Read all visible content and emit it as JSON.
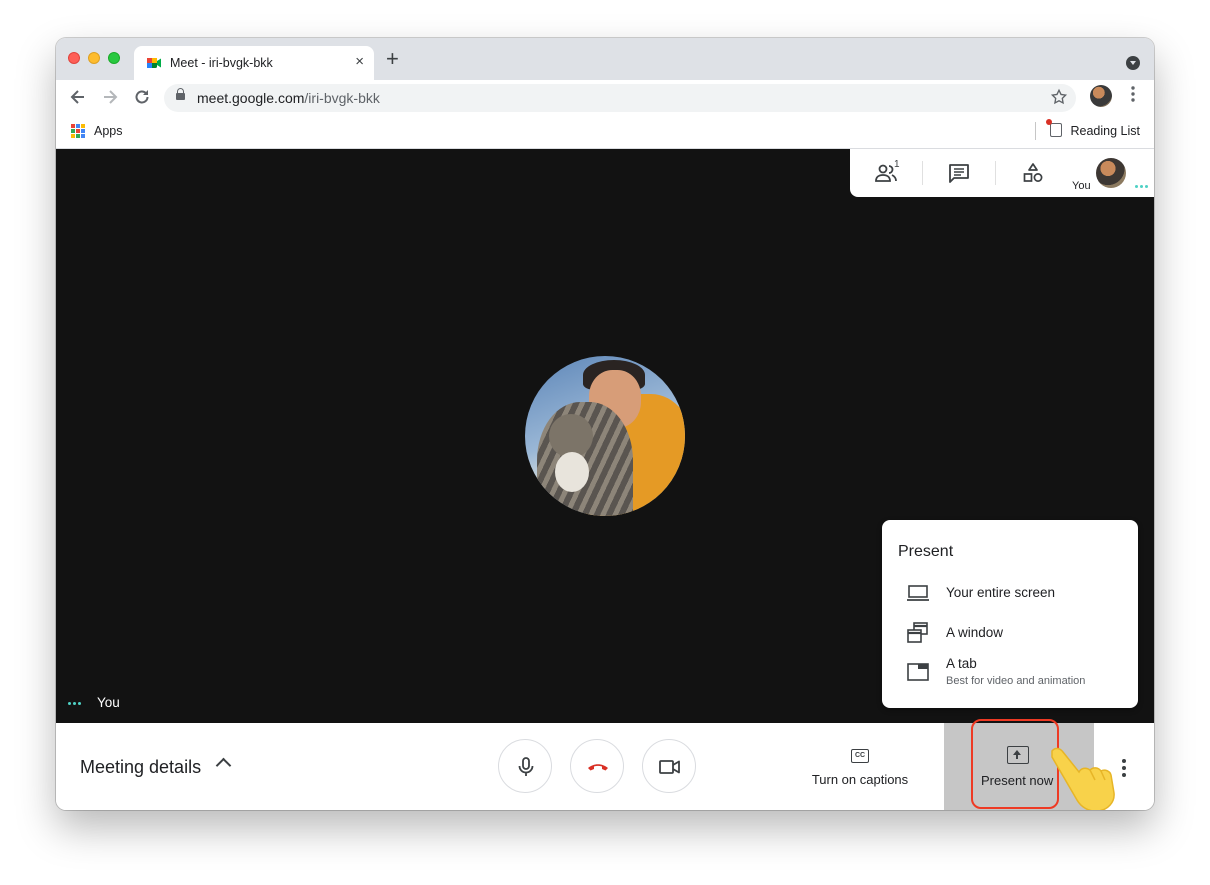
{
  "browser": {
    "tab_title": "Meet - iri-bvgk-bkk",
    "tab_close": "×",
    "new_tab": "+",
    "url_host": "meet.google.com",
    "url_path": "/iri-bvgk-bkk",
    "bookmarks": {
      "apps_label": "Apps",
      "reading_list_label": "Reading List"
    }
  },
  "meet": {
    "self_tile_name": "You",
    "top_panel": {
      "participant_count": "1",
      "you_label": "You"
    },
    "present_menu": {
      "title": "Present",
      "items": [
        {
          "label": "Your entire screen",
          "subtitle": ""
        },
        {
          "label": "A window",
          "subtitle": ""
        },
        {
          "label": "A tab",
          "subtitle": "Best for video and animation"
        }
      ]
    },
    "bottom_bar": {
      "meeting_details": "Meeting details",
      "captions_label": "Turn on captions",
      "captions_icon_text": "CC",
      "present_now_label": "Present now"
    }
  },
  "colors": {
    "stage_bg": "#121212",
    "accent_teal": "#4fd1c5",
    "end_call_red": "#d93025",
    "highlight_red": "#ee3a24"
  },
  "icons": [
    "google-meet-favicon",
    "back-arrow-icon",
    "forward-arrow-icon",
    "reload-icon",
    "lock-icon",
    "star-icon",
    "apps-grid-icon",
    "reading-list-icon",
    "people-icon",
    "chat-icon",
    "activities-icon",
    "microphone-icon",
    "end-call-icon",
    "camera-icon",
    "captions-icon",
    "present-screen-icon",
    "monitor-icon",
    "window-icon",
    "tab-icon",
    "more-options-icon"
  ]
}
